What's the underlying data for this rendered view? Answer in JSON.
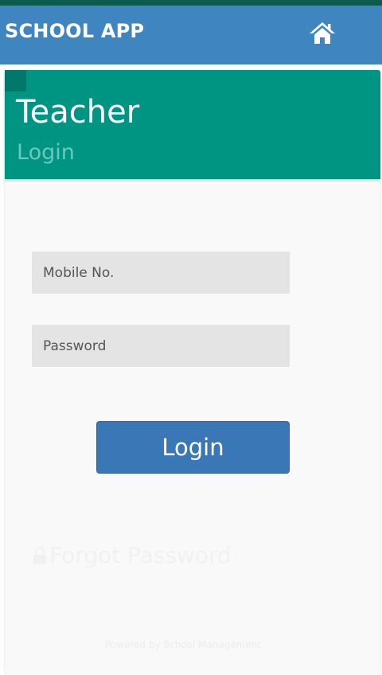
{
  "app_bar": {
    "title": "SCHOOL APP",
    "home_icon": "home-icon"
  },
  "card": {
    "title": "Teacher",
    "subtitle": "Login"
  },
  "form": {
    "mobile_placeholder": "Mobile No.",
    "password_placeholder": "Password",
    "login_label": "Login",
    "forgot_label": "Forgot Password",
    "forgot_icon": "lock-icon"
  },
  "footer": {
    "text": "Powered by School Management"
  },
  "colors": {
    "app_bar": "#3f86c0",
    "card_header": "#009483",
    "button": "#3a77b6",
    "input_background": "#e4e4e4"
  }
}
